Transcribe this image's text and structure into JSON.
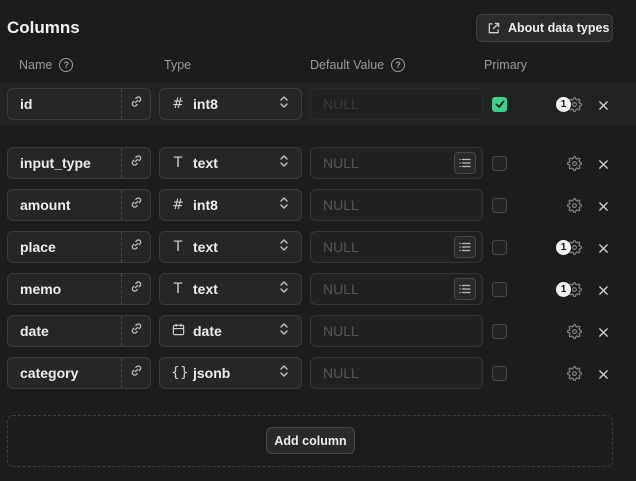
{
  "header": {
    "title": "Columns",
    "about_label": "About data types"
  },
  "column_headers": {
    "name": "Name",
    "type": "Type",
    "default_value": "Default Value",
    "primary": "Primary"
  },
  "help_glyph": "?",
  "rows": [
    {
      "name": "id",
      "type": "int8",
      "type_glyph": "#",
      "default_placeholder": "NULL",
      "primary": true,
      "badge": "1",
      "list_button": false,
      "dim_default": true
    },
    {
      "name": "input_type",
      "type": "text",
      "type_glyph": "T",
      "default_placeholder": "NULL",
      "primary": false,
      "badge": "",
      "list_button": true,
      "dim_default": false
    },
    {
      "name": "amount",
      "type": "int8",
      "type_glyph": "#",
      "default_placeholder": "NULL",
      "primary": false,
      "badge": "",
      "list_button": false,
      "dim_default": false
    },
    {
      "name": "place",
      "type": "text",
      "type_glyph": "T",
      "default_placeholder": "NULL",
      "primary": false,
      "badge": "1",
      "list_button": true,
      "dim_default": false
    },
    {
      "name": "memo",
      "type": "text",
      "type_glyph": "T",
      "default_placeholder": "NULL",
      "primary": false,
      "badge": "1",
      "list_button": true,
      "dim_default": false
    },
    {
      "name": "date",
      "type": "date",
      "type_glyph": "calendar",
      "default_placeholder": "NULL",
      "primary": false,
      "badge": "",
      "list_button": false,
      "dim_default": false
    },
    {
      "name": "category",
      "type": "jsonb",
      "type_glyph": "{}",
      "default_placeholder": "NULL",
      "primary": false,
      "badge": "",
      "list_button": false,
      "dim_default": false
    }
  ],
  "add_column_label": "Add column",
  "colors": {
    "accent": "#3ecf8e",
    "background": "#1c1c1c"
  }
}
